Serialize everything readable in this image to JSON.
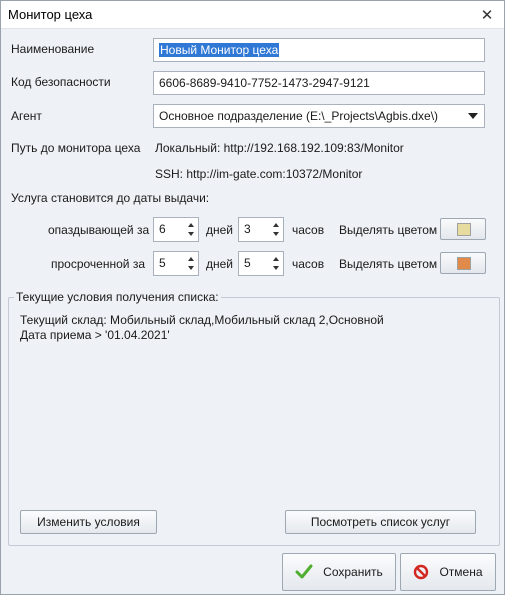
{
  "window": {
    "title": "Монитор цеха"
  },
  "form": {
    "name_label": "Наименование",
    "name_value": "Новый Монитор цеха",
    "security_label": "Код безопасности",
    "security_value": "6606-8689-9410-7752-1473-2947-9121",
    "agent_label": "Агент",
    "agent_value": "Основное подразделение (E:\\_Projects\\Agbis.dxe\\)",
    "path_label": "Путь до монитора цеха",
    "local_path": "Локальный: http://192.168.192.109:83/Monitor",
    "ssh_path": "SSH: http://im-gate.com:10372/Monitor"
  },
  "service": {
    "heading": "Услуга становится до даты выдачи:",
    "late": {
      "label": "опаздывающей за",
      "days": "6",
      "days_unit": "дней",
      "hours": "3",
      "hours_unit": "часов",
      "color_label": "Выделять цветом",
      "color": "#e6dca0"
    },
    "overdue": {
      "label": "просроченной за",
      "days": "5",
      "days_unit": "дней",
      "hours": "5",
      "hours_unit": "часов",
      "color_label": "Выделять цветом",
      "color": "#e08b4a"
    }
  },
  "conditions": {
    "title": "Текущие условия получения списка:",
    "lines": [
      "Текущий склад: Мобильный склад,Мобильный склад 2,Основной",
      "Дата приема > '01.04.2021'"
    ],
    "change_button": "Изменить условия",
    "view_button": "Посмотреть список услуг"
  },
  "footer": {
    "save_button": "Сохранить",
    "cancel_button": "Отмена"
  }
}
